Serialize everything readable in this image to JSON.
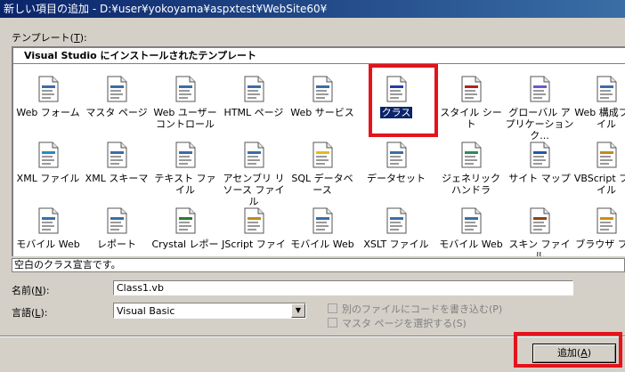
{
  "window": {
    "title": "新しい項目の追加 - D:¥user¥yokoyama¥aspxtest¥WebSite60¥"
  },
  "templates": {
    "label": "テンプレート(",
    "label_key": "T",
    "label_end": "):",
    "section_header": "Visual Studio にインストールされたテンプレート",
    "rows": [
      [
        {
          "name": "Web フォーム",
          "icon": "web-form-icon"
        },
        {
          "name": "マスタ ページ",
          "icon": "master-page-icon"
        },
        {
          "name": "Web ユーザー コントロール",
          "icon": "web-user-control-icon"
        },
        {
          "name": "HTML ページ",
          "icon": "html-page-icon"
        },
        {
          "name": "Web サービス",
          "icon": "web-service-icon"
        },
        {
          "name": "クラス",
          "icon": "class-icon",
          "selected": true
        },
        {
          "name": "スタイル シート",
          "icon": "style-sheet-icon"
        },
        {
          "name": "グローバル アプリケーション ク...",
          "icon": "global-app-icon"
        },
        {
          "name": "Web 構成ファイル",
          "icon": "web-config-icon"
        }
      ],
      [
        {
          "name": "XML ファイル",
          "icon": "xml-file-icon"
        },
        {
          "name": "XML スキーマ",
          "icon": "xml-schema-icon"
        },
        {
          "name": "テキスト ファイル",
          "icon": "text-file-icon"
        },
        {
          "name": "アセンブリ リソース ファイル",
          "icon": "resource-file-icon"
        },
        {
          "name": "SQL データベース",
          "icon": "sql-database-icon"
        },
        {
          "name": "データセット",
          "icon": "dataset-icon"
        },
        {
          "name": "ジェネリック ハンドラ",
          "icon": "generic-handler-icon"
        },
        {
          "name": "サイト マップ",
          "icon": "site-map-icon"
        },
        {
          "name": "VBScript ファイル",
          "icon": "vbscript-file-icon"
        }
      ],
      [
        {
          "name": "モバイル Web",
          "icon": "mobile-web-form-icon"
        },
        {
          "name": "レポート",
          "icon": "report-icon"
        },
        {
          "name": "Crystal レポー",
          "icon": "crystal-report-icon"
        },
        {
          "name": "JScript ファイ",
          "icon": "jscript-file-icon"
        },
        {
          "name": "モバイル Web",
          "icon": "mobile-web-user-control-icon"
        },
        {
          "name": "XSLT ファイル",
          "icon": "xslt-file-icon"
        },
        {
          "name": "モバイル Web",
          "icon": "mobile-web-config-icon"
        },
        {
          "name": "スキン ファイル",
          "icon": "skin-file-icon"
        },
        {
          "name": "ブラウザ ファ",
          "icon": "browser-file-icon"
        }
      ]
    ]
  },
  "description": "空白のクラス宣言です。",
  "name_field": {
    "label": "名前(",
    "key": "N",
    "label_end": "):",
    "value": "Class1.vb"
  },
  "language": {
    "label": "言語(",
    "key": "L",
    "label_end": "):",
    "value": "Visual Basic"
  },
  "options": {
    "separate_code": "別のファイルにコードを書き込む(P)",
    "select_master": "マスタ ページを選択する(S)"
  },
  "add_button": {
    "label": "追加(",
    "key": "A",
    "label_end": ")"
  },
  "colors": {
    "highlight": "#e3141b",
    "selection": "#0a246a",
    "dialog": "#d4d0c8"
  }
}
